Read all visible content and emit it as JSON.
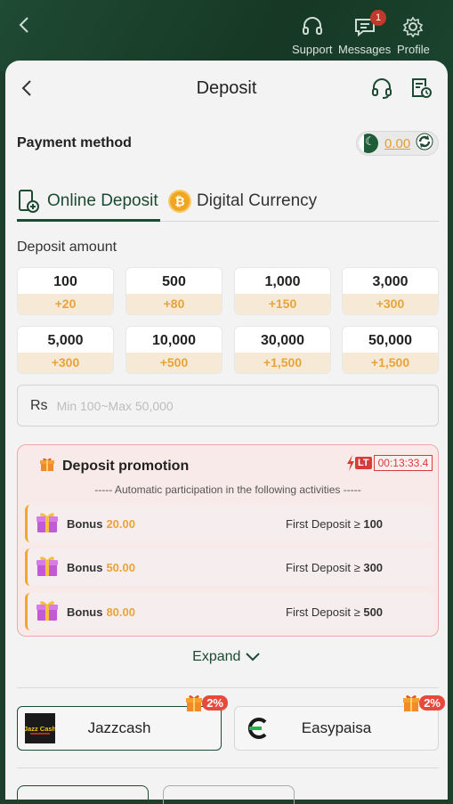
{
  "topbar": {
    "support_label": "Support",
    "messages_label": "Messages",
    "profile_label": "Profile",
    "messages_badge": "1"
  },
  "header": {
    "title": "Deposit"
  },
  "payment_method": {
    "label": "Payment method",
    "balance": "0.00"
  },
  "tabs": [
    {
      "label": "Online Deposit"
    },
    {
      "label": "Digital Currency"
    }
  ],
  "deposit_amount": {
    "label": "Deposit amount",
    "options": [
      {
        "value": "100",
        "bonus": "+20"
      },
      {
        "value": "500",
        "bonus": "+80"
      },
      {
        "value": "1,000",
        "bonus": "+150"
      },
      {
        "value": "3,000",
        "bonus": "+300"
      },
      {
        "value": "5,000",
        "bonus": "+300"
      },
      {
        "value": "10,000",
        "bonus": "+500"
      },
      {
        "value": "30,000",
        "bonus": "+1,500"
      },
      {
        "value": "50,000",
        "bonus": "+1,500"
      }
    ],
    "currency_prefix": "Rs",
    "placeholder": "Min 100~Max 50,000"
  },
  "promotion": {
    "title": "Deposit promotion",
    "lt_label": "LT",
    "timer": "00:13:33.4",
    "subtitle": "----- Automatic participation in the following activities -----",
    "items": [
      {
        "label": "Bonus",
        "amount": "20.00",
        "condition": "First Deposit ≥",
        "threshold": "100"
      },
      {
        "label": "Bonus",
        "amount": "50.00",
        "condition": "First Deposit ≥",
        "threshold": "300"
      },
      {
        "label": "Bonus",
        "amount": "80.00",
        "condition": "First Deposit ≥",
        "threshold": "500"
      }
    ]
  },
  "expand_label": "Expand",
  "payment_options": [
    {
      "name": "Jazzcash",
      "badge": "2%",
      "logo_text": "Jazz Cash"
    },
    {
      "name": "Easypaisa",
      "badge": "2%"
    }
  ],
  "colors": {
    "primary": "#1d4a33",
    "accent_gold": "#e8a33a",
    "promo_red": "#d93a3a"
  }
}
